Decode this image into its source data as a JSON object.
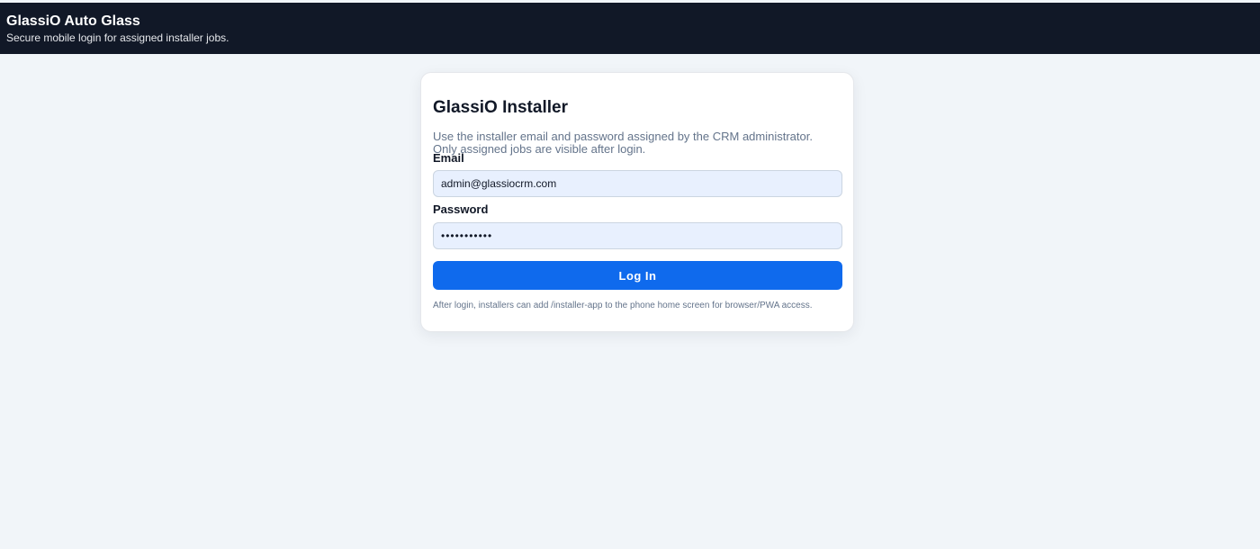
{
  "header": {
    "title": "GlassiO Auto Glass",
    "subtitle": "Secure mobile login for assigned installer jobs."
  },
  "login": {
    "title": "GlassiO Installer",
    "description": "Use the installer email and password assigned by the CRM administrator. Only assigned jobs are visible after login.",
    "email_label": "Email",
    "email_value": "admin@glassiocrm.com",
    "password_label": "Password",
    "password_value": "abcdefghijk",
    "submit_label": "Log In",
    "footnote": "After login, installers can add /installer-app to the phone home screen for browser/PWA access."
  },
  "colors": {
    "header_bg": "#111827",
    "page_bg": "#f1f5f9",
    "button_bg": "#0f6aed",
    "input_bg": "#e8f0fe"
  }
}
